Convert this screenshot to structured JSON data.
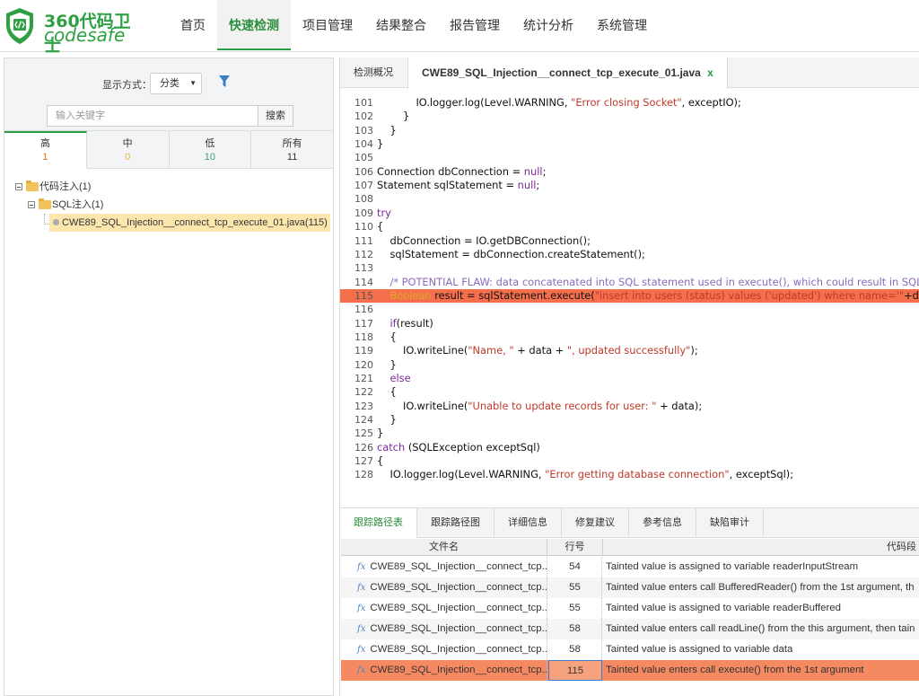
{
  "brand": {
    "cn": "360代码卫士",
    "en": "codesafe"
  },
  "nav": [
    {
      "label": "首页",
      "active": false
    },
    {
      "label": "快速检测",
      "active": true
    },
    {
      "label": "项目管理",
      "active": false
    },
    {
      "label": "结果整合",
      "active": false
    },
    {
      "label": "报告管理",
      "active": false
    },
    {
      "label": "统计分析",
      "active": false
    },
    {
      "label": "系统管理",
      "active": false
    }
  ],
  "left_panel": {
    "display_label": "显示方式：",
    "display_value": "分类",
    "search_placeholder": "输入关键字",
    "search_button": "搜索",
    "severity_tabs": [
      {
        "name": "高",
        "count": "1"
      },
      {
        "name": "中",
        "count": "0"
      },
      {
        "name": "低",
        "count": "10"
      },
      {
        "name": "所有",
        "count": "11"
      }
    ],
    "tree": {
      "root": "代码注入(1)",
      "child": "SQL注入(1)",
      "leaf": "CWE89_SQL_Injection__connect_tcp_execute_01.java(115)"
    }
  },
  "file_tabs": {
    "overview": "检测概况",
    "file": "CWE89_SQL_Injection__connect_tcp_execute_01.java",
    "close": "x"
  },
  "code": {
    "highlight_line": "115",
    "lines": [
      {
        "n": "101",
        "t": "            IO.logger.log(Level.WARNING, \"Error closing Socket\", exceptIO);"
      },
      {
        "n": "102",
        "t": "        }"
      },
      {
        "n": "103",
        "t": "    }"
      },
      {
        "n": "104",
        "t": "}"
      },
      {
        "n": "105",
        "t": ""
      },
      {
        "n": "106",
        "t": "Connection dbConnection = null;"
      },
      {
        "n": "107",
        "t": "Statement sqlStatement = null;"
      },
      {
        "n": "108",
        "t": ""
      },
      {
        "n": "109",
        "t": "try"
      },
      {
        "n": "110",
        "t": "{"
      },
      {
        "n": "111",
        "t": "    dbConnection = IO.getDBConnection();"
      },
      {
        "n": "112",
        "t": "    sqlStatement = dbConnection.createStatement();"
      },
      {
        "n": "113",
        "t": ""
      },
      {
        "n": "114",
        "t": "    /* POTENTIAL FLAW: data concatenated into SQL statement used in execute(), which could result in SQL Injection */"
      },
      {
        "n": "115",
        "t": "    Boolean result = sqlStatement.execute(\"insert into users (status) values ('updated') where name='\"+data+\"'\");"
      },
      {
        "n": "116",
        "t": ""
      },
      {
        "n": "117",
        "t": "    if(result)"
      },
      {
        "n": "118",
        "t": "    {"
      },
      {
        "n": "119",
        "t": "        IO.writeLine(\"Name, \" + data + \", updated successfully\");"
      },
      {
        "n": "120",
        "t": "    }"
      },
      {
        "n": "121",
        "t": "    else"
      },
      {
        "n": "122",
        "t": "    {"
      },
      {
        "n": "123",
        "t": "        IO.writeLine(\"Unable to update records for user: \" + data);"
      },
      {
        "n": "124",
        "t": "    }"
      },
      {
        "n": "125",
        "t": "}"
      },
      {
        "n": "126",
        "t": "catch (SQLException exceptSql)"
      },
      {
        "n": "127",
        "t": "{"
      },
      {
        "n": "128",
        "t": "    IO.logger.log(Level.WARNING, \"Error getting database connection\", exceptSql);"
      }
    ]
  },
  "bottom_tabs": [
    {
      "label": "跟踪路径表",
      "active": true
    },
    {
      "label": "跟踪路径图",
      "active": false
    },
    {
      "label": "详细信息",
      "active": false
    },
    {
      "label": "修复建议",
      "active": false
    },
    {
      "label": "参考信息",
      "active": false
    },
    {
      "label": "缺陷审计",
      "active": false
    }
  ],
  "trace_table": {
    "headers": {
      "file": "文件名",
      "line": "行号",
      "snippet": "代码段"
    },
    "rows": [
      {
        "file": "CWE89_SQL_Injection__connect_tcp...",
        "line": "54",
        "desc": "Tainted value is assigned to variable readerInputStream"
      },
      {
        "file": "CWE89_SQL_Injection__connect_tcp...",
        "line": "55",
        "desc": "Tainted value enters call BufferedReader() from the 1st argument, th"
      },
      {
        "file": "CWE89_SQL_Injection__connect_tcp...",
        "line": "55",
        "desc": "Tainted value is assigned to variable readerBuffered"
      },
      {
        "file": "CWE89_SQL_Injection__connect_tcp...",
        "line": "58",
        "desc": "Tainted value enters call readLine() from the this argument, then tain"
      },
      {
        "file": "CWE89_SQL_Injection__connect_tcp...",
        "line": "58",
        "desc": "Tainted value is assigned to variable data"
      },
      {
        "file": "CWE89_SQL_Injection__connect_tcp...",
        "line": "115",
        "desc": "Tainted value enters call execute() from the 1st argument",
        "selected": true
      }
    ],
    "fx_label": "fx"
  },
  "colors": {
    "brand": "#2ea043",
    "highlight": "#f56f4c",
    "selected_row": "#f58a62"
  }
}
